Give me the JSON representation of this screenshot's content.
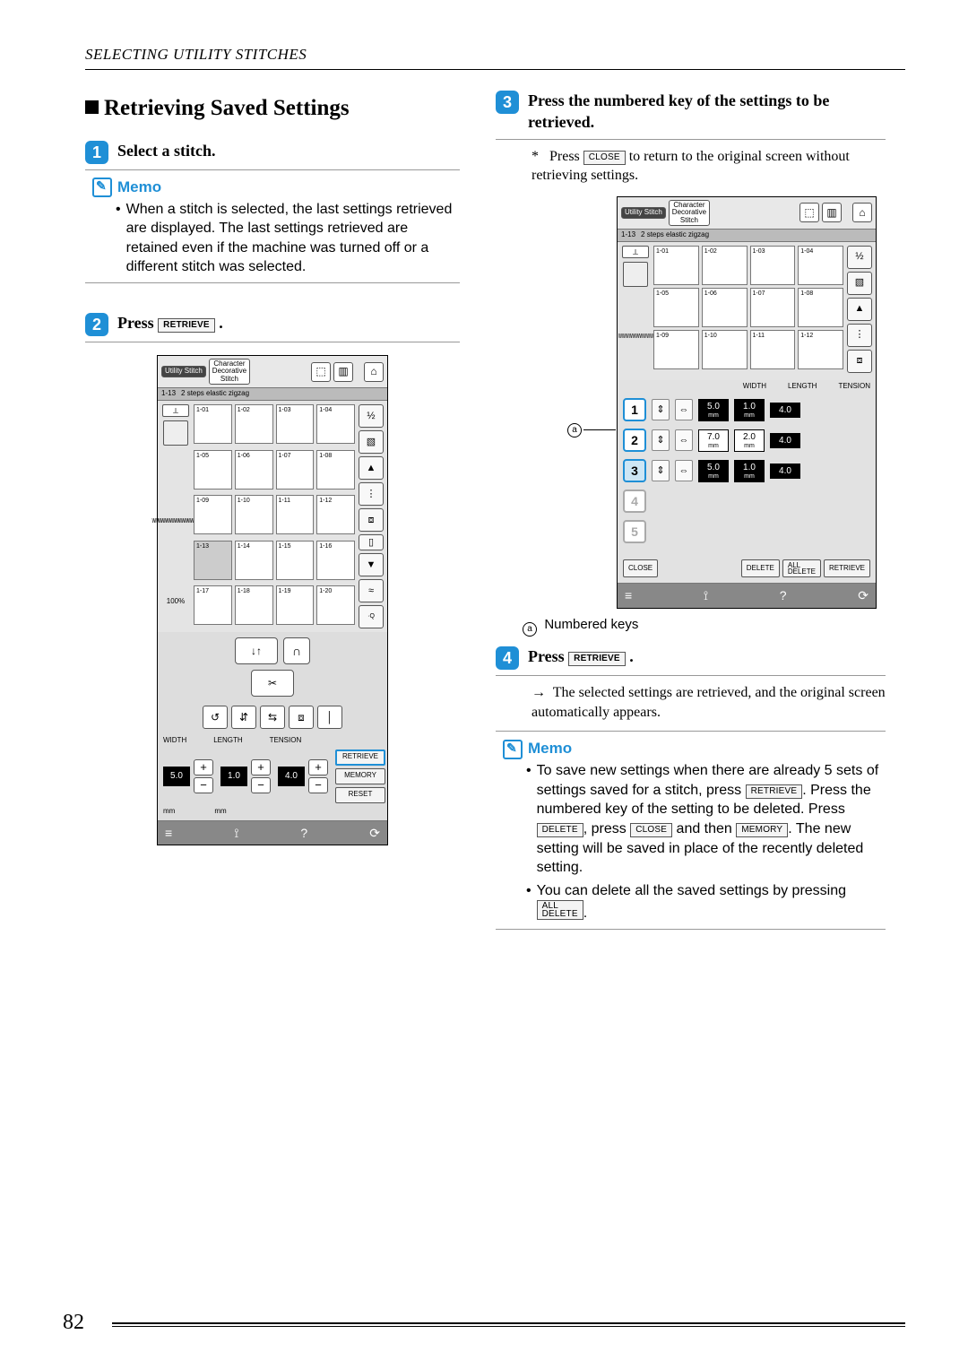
{
  "header": "SELECTING UTILITY STITCHES",
  "page_number": "82",
  "section_title": "Retrieving Saved Settings",
  "steps": {
    "s1": {
      "num": "1",
      "text": "Select a stitch."
    },
    "s2": {
      "num": "2",
      "text": "Press "
    },
    "s3": {
      "num": "3",
      "text": "Press the numbered key of the settings to be retrieved."
    },
    "s4": {
      "num": "4",
      "text": "Press "
    }
  },
  "keys": {
    "retrieve": "RETRIEVE",
    "close": "CLOSE",
    "delete": "DELETE",
    "all_delete": "ALL\nDELETE",
    "memory": "MEMORY",
    "reset": "RESET"
  },
  "memo1": {
    "title": "Memo",
    "bullet": "When a stitch is selected, the last settings retrieved are displayed. The last settings retrieved are retained even if the machine was turned off or a different stitch was selected."
  },
  "step3_note": {
    "asterisk": "*",
    "t1": "Press ",
    "t2": " to return to the original screen without retrieving settings."
  },
  "step4_note": {
    "arrow": "→",
    "text": "The selected settings are retrieved, and the original screen automatically appears."
  },
  "callout1": {
    "num": "a",
    "label": "Numbered keys"
  },
  "memo2": {
    "title": "Memo",
    "b1a": "To save new settings when there are already 5 sets of settings saved for a stitch, press ",
    "b1b": ". Press the numbered key of the setting to be deleted. Press ",
    "b1c": ", press ",
    "b1d": " and then ",
    "b1e": ". The new setting will be saved in place of the recently deleted setting.",
    "b2a": "You can delete all the saved settings by pressing ",
    "b2b": "."
  },
  "lcd": {
    "tab1": "Utility Stitch",
    "tab2": "Character\nDecorative\nStitch",
    "banner_id": "1-13",
    "banner": "2 steps elastic zigzag",
    "percent": "100%",
    "width_label": "WIDTH",
    "length_label": "LENGTH",
    "tension_label": "TENSION",
    "width_val": "5.0",
    "length_val": "1.0",
    "tension_val": "4.0",
    "mm": "mm",
    "cells": [
      "1-01",
      "1-02",
      "1-03",
      "1-04",
      "1-05",
      "1-06",
      "1-07",
      "1-08",
      "1-09",
      "1-10",
      "1-11",
      "1-12",
      "1-13",
      "1-14",
      "1-15",
      "1-16",
      "1-17",
      "1-18",
      "1-19",
      "1-20"
    ],
    "half": "½",
    "up": "▲",
    "down": "▼"
  },
  "lcdR": {
    "cells": [
      "1-01",
      "1-02",
      "1-03",
      "1-04",
      "1-05",
      "1-06",
      "1-07",
      "1-08",
      "1-09",
      "1-10",
      "1-11",
      "1-12"
    ],
    "cols": {
      "width": "WIDTH",
      "length": "LENGTH",
      "tension": "TENSION"
    },
    "rows": [
      {
        "n": "1",
        "w": "5.0",
        "l": "1.0",
        "t": "4.0"
      },
      {
        "n": "2",
        "w": "7.0",
        "l": "2.0",
        "t": "4.0"
      },
      {
        "n": "3",
        "w": "5.0",
        "l": "1.0",
        "t": "4.0"
      },
      {
        "n": "4",
        "w": "",
        "l": "",
        "t": ""
      },
      {
        "n": "5",
        "w": "",
        "l": "",
        "t": ""
      }
    ]
  }
}
